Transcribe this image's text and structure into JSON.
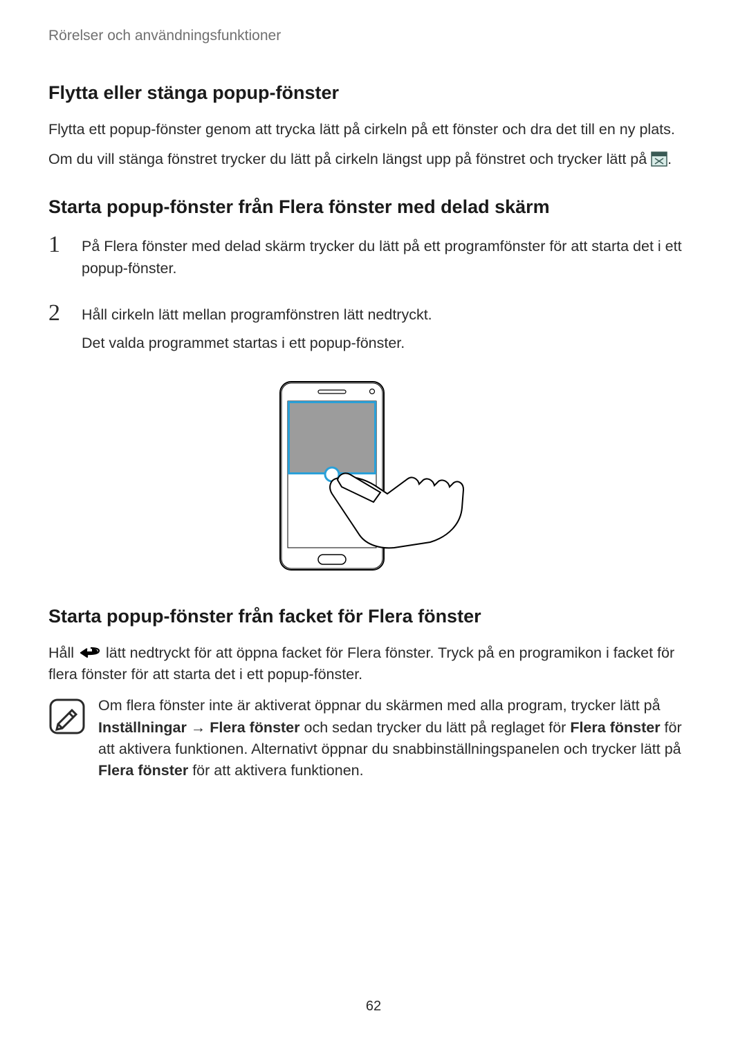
{
  "breadcrumb": "Rörelser och användningsfunktioner",
  "section1": {
    "title": "Flytta eller stänga popup-fönster",
    "p1": "Flytta ett popup-fönster genom att trycka lätt på cirkeln på ett fönster och dra det till en ny plats.",
    "p2_prefix": "Om du vill stänga fönstret trycker du lätt på cirkeln längst upp på fönstret och trycker lätt på ",
    "p2_suffix": "."
  },
  "section2": {
    "title": "Starta popup-fönster från Flera fönster med delad skärm",
    "step1": "På Flera fönster med delad skärm trycker du lätt på ett programfönster för att starta det i ett popup-fönster.",
    "step2a": "Håll cirkeln lätt mellan programfönstren lätt nedtryckt.",
    "step2b": "Det valda programmet startas i ett popup-fönster."
  },
  "section3": {
    "title": "Starta popup-fönster från facket för Flera fönster",
    "p1_prefix": "Håll ",
    "p1_suffix": " lätt nedtryckt för att öppna facket för Flera fönster. Tryck på en programikon i facket för flera fönster för att starta det i ett popup-fönster.",
    "note": {
      "t1": "Om flera fönster inte är aktiverat öppnar du skärmen med alla program, trycker lätt på ",
      "b1": "Inställningar",
      "arrow": " → ",
      "b2": "Flera fönster",
      "t2": " och sedan trycker du lätt på reglaget för ",
      "b3": "Flera fönster",
      "t3": " för att aktivera funktionen. Alternativt öppnar du snabbinställningspanelen och trycker lätt på ",
      "b4": "Flera fönster",
      "t4": " för att aktivera funktionen."
    }
  },
  "page_number": "62"
}
